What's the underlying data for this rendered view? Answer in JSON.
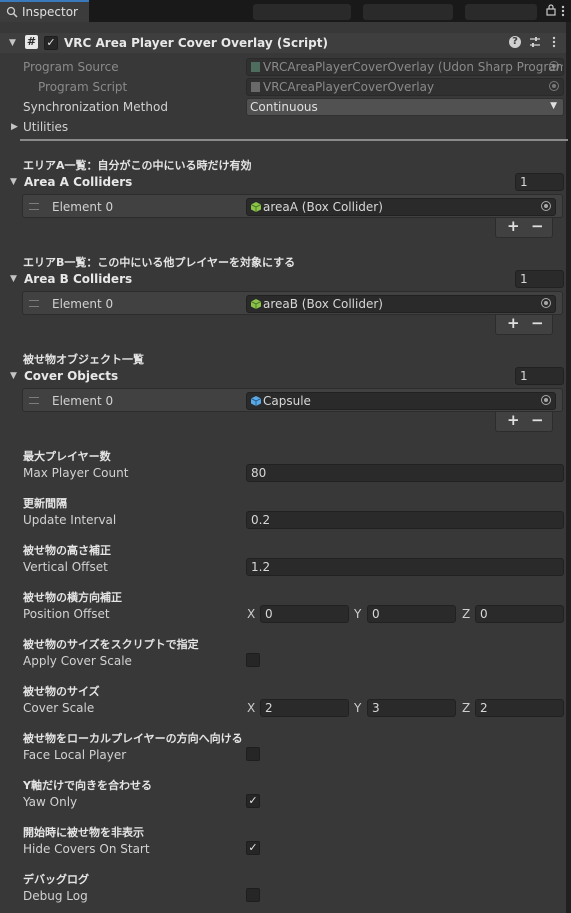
{
  "tab": {
    "title": "Inspector"
  },
  "component": {
    "title": "VRC Area Player Cover Overlay (Script)",
    "enabled": true
  },
  "program_source": {
    "label": "Program Source",
    "value": "VRCAreaPlayerCoverOverlay (Udon Sharp Program Asset)"
  },
  "program_script": {
    "label": "Program Script",
    "value": "VRCAreaPlayerCoverOverlay"
  },
  "sync_method": {
    "label": "Synchronization Method",
    "value": "Continuous"
  },
  "utilities": {
    "label": "Utilities"
  },
  "area_a": {
    "header": "エリアA一覧：自分がこの中にいる時だけ有効",
    "label": "Area A Colliders",
    "size": "1",
    "element_label": "Element 0",
    "element_value": "areaA (Box Collider)"
  },
  "area_b": {
    "header": "エリアB一覧：この中にいる他プレイヤーを対象にする",
    "label": "Area B Colliders",
    "size": "1",
    "element_label": "Element 0",
    "element_value": "areaB (Box Collider)"
  },
  "cover_objects": {
    "header": "被せ物オブジェクト一覧",
    "label": "Cover Objects",
    "size": "1",
    "element_label": "Element 0",
    "element_value": "Capsule"
  },
  "list_controls": {
    "plus": "+",
    "minus": "−"
  },
  "max_player_count": {
    "header": "最大プレイヤー数",
    "label": "Max Player Count",
    "value": "80"
  },
  "update_interval": {
    "header": "更新間隔",
    "label": "Update Interval",
    "value": "0.2"
  },
  "vertical_offset": {
    "header": "被せ物の高さ補正",
    "label": "Vertical Offset",
    "value": "1.2"
  },
  "position_offset": {
    "header": "被せ物の横方向補正",
    "label": "Position Offset",
    "x_label": "X",
    "x": "0",
    "y_label": "Y",
    "y": "0",
    "z_label": "Z",
    "z": "0"
  },
  "apply_cover_scale": {
    "header": "被せ物のサイズをスクリプトで指定",
    "label": "Apply Cover Scale",
    "checked": false
  },
  "cover_scale": {
    "header": "被せ物のサイズ",
    "label": "Cover Scale",
    "x_label": "X",
    "x": "2",
    "y_label": "Y",
    "y": "3",
    "z_label": "Z",
    "z": "2"
  },
  "face_local_player": {
    "header": "被せ物をローカルプレイヤーの方向へ向ける",
    "label": "Face Local Player",
    "checked": false
  },
  "yaw_only": {
    "header": "Y軸だけで向きを合わせる",
    "label": "Yaw Only",
    "checked": true
  },
  "hide_covers": {
    "header": "開始時に被せ物を非表示",
    "label": "Hide Covers On Start",
    "checked": true
  },
  "debug_log": {
    "header": "デバッグログ",
    "label": "Debug Log",
    "checked": false
  },
  "colors": {
    "accent": "#3a79bb",
    "collider_icon": "#8bc34a",
    "capsule_icon": "#5aa9e6"
  }
}
